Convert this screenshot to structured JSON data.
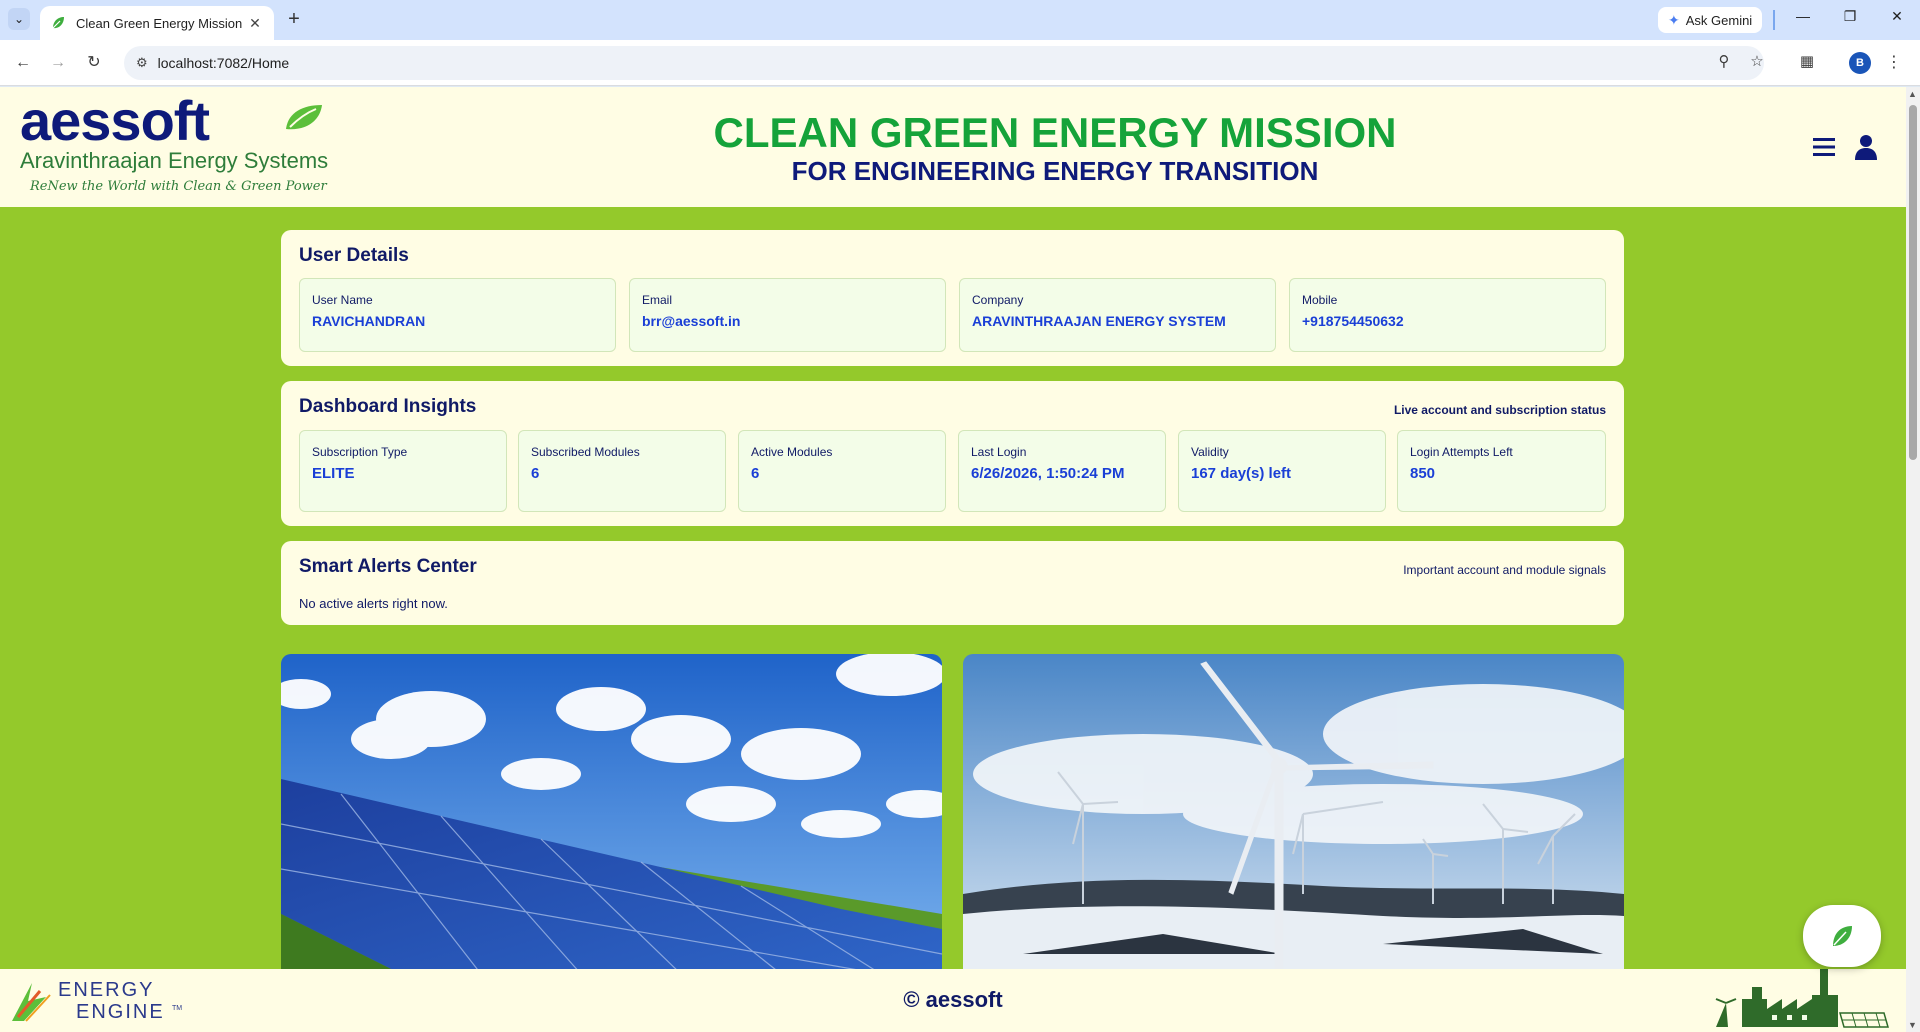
{
  "browser": {
    "tab_title": "Clean Green Energy Mission",
    "url": "localhost:7082/Home",
    "gemini_label": "Ask Gemini",
    "profile_initial": "B"
  },
  "header": {
    "logo_brand": "aessoft",
    "logo_company": "Aravinthraajan Energy Systems",
    "logo_tagline": "ReNew the World with Clean & Green Power",
    "title": "CLEAN GREEN ENERGY MISSION",
    "subtitle": "FOR ENGINEERING ENERGY TRANSITION"
  },
  "user_details": {
    "heading": "User Details",
    "fields": [
      {
        "label": "User Name",
        "value": "RAVICHANDRAN"
      },
      {
        "label": "Email",
        "value": "brr@aessoft.in"
      },
      {
        "label": "Company",
        "value": "ARAVINTHRAAJAN ENERGY SYSTEM"
      },
      {
        "label": "Mobile",
        "value": "+918754450632"
      }
    ]
  },
  "insights": {
    "heading": "Dashboard Insights",
    "note": "Live account and subscription status",
    "fields": [
      {
        "label": "Subscription Type",
        "value": "ELITE"
      },
      {
        "label": "Subscribed Modules",
        "value": "6"
      },
      {
        "label": "Active Modules",
        "value": "6"
      },
      {
        "label": "Last Login",
        "value": "6/26/2026, 1:50:24 PM"
      },
      {
        "label": "Validity",
        "value": "167 day(s) left"
      },
      {
        "label": "Login Attempts Left",
        "value": "850"
      }
    ]
  },
  "alerts": {
    "heading": "Smart Alerts Center",
    "note": "Important account and module signals",
    "message": "No active alerts right now."
  },
  "footer": {
    "energy_engine_top": "ENERGY",
    "energy_engine_bottom": "ENGINE",
    "tm": "TM",
    "copyright": "© aessoft"
  },
  "colors": {
    "page_green": "#94c92b",
    "panel_cream": "#fffde4",
    "navy": "#101a66",
    "value_blue": "#1a3fd6",
    "title_green": "#15a33a"
  }
}
